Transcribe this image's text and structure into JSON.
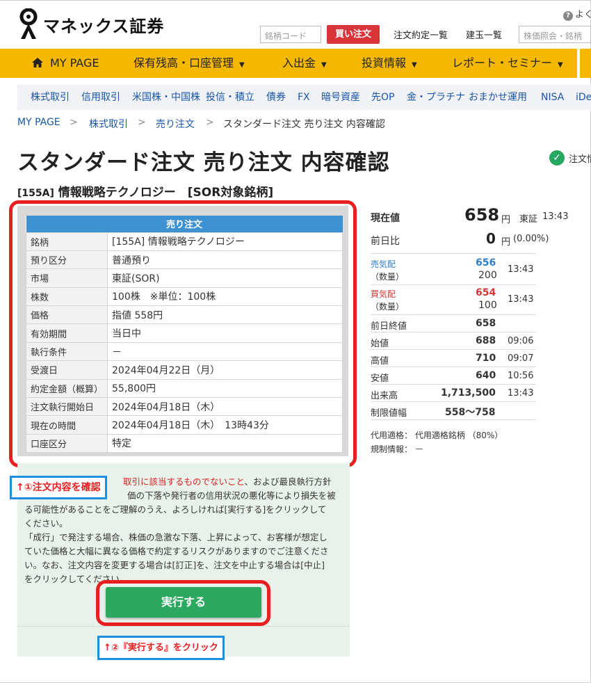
{
  "header": {
    "brand": "マネックス証券",
    "help_text": "よく",
    "code_input_placeholder": "銘柄コード",
    "buy_order_label": "買い注文",
    "links": [
      "注文約定一覧",
      "建玉一覧"
    ],
    "stock_search_placeholder": "株価照会・銘柄"
  },
  "main_nav": {
    "home": "MY PAGE",
    "items": [
      "保有残高・口座管理",
      "入出金",
      "投資情報",
      "レポート・セミナー"
    ]
  },
  "sub_nav": [
    "株式取引",
    "信用取引",
    "米国株・中国株",
    "投信・積立",
    "債券",
    "FX",
    "暗号資産",
    "先OP",
    "金・プラチナ",
    "おまかせ運用",
    "NISA",
    "iDe"
  ],
  "breadcrumb": [
    "MY PAGE",
    "株式取引",
    "売り注文",
    "スタンダード注文 売り注文 内容確認"
  ],
  "page_title": "スタンダード注文 売り注文 内容確認",
  "status_chip": "注文情",
  "stock": {
    "code": "[155A]",
    "name": "情報戦略テクノロジー　[SOR対象銘柄]"
  },
  "order": {
    "caption": "売り注文",
    "rows": [
      {
        "label": "銘柄",
        "value": "[155A] 情報戦略テクノロジー"
      },
      {
        "label": "預り区分",
        "value": "普通預り"
      },
      {
        "label": "市場",
        "value": "東証(SOR)"
      },
      {
        "label": "株数",
        "value": "100株　※単位：100株"
      },
      {
        "label": "価格",
        "value": "指値 558円"
      },
      {
        "label": "有効期間",
        "value": "当日中"
      },
      {
        "label": "執行条件",
        "value": "－"
      },
      {
        "label": "受渡日",
        "value": "2024年04月22日（月）"
      },
      {
        "label": "約定金額（概算）",
        "value": "55,800円"
      },
      {
        "label": "注文執行開始日",
        "value": "2024年04月18日（木）"
      },
      {
        "label": "現在の時間",
        "value": "2024年04月18日（木）　13時43分"
      },
      {
        "label": "口座区分",
        "value": "特定"
      }
    ]
  },
  "notice": {
    "line1_red": "取引に該当するものでないこと",
    "line1_rest": "、および最良執行方針",
    "line2": "価の下落や発行者の信用状況の悪化等により損失を被",
    "line3": "る可能性があることをご理解のうえ、よろしければ[実行する]をクリックして",
    "line4": "ください。",
    "line5": "「成行」で発注する場合、株価の急激な下落、上昇によって、お客様が想定し",
    "line6": "ていた価格と大幅に異なる価格で約定するリスクがありますのでご注意くださ",
    "line7": "い。なお、注文内容を変更する場合は[訂正]を、注文を中止する場合は[中止]",
    "line8": "をクリックしてください。"
  },
  "execute_label": "実行する",
  "callouts": {
    "one": "↑①注文内容を確認",
    "two": "↑②『実行する』をクリック"
  },
  "quote": {
    "current_label": "現在値",
    "current_value": "658",
    "current_unit": "円",
    "market": "東証",
    "current_time": "13:43",
    "change_label": "前日比",
    "change_value": "0",
    "change_unit": "円",
    "change_pct": "(0.00%)",
    "ask_label": "売気配",
    "ask_value": "656",
    "ask_qty_label": "（数量）",
    "ask_qty": "200",
    "ask_time": "13:43",
    "bid_label": "買気配",
    "bid_value": "654",
    "bid_qty_label": "（数量）",
    "bid_qty": "100",
    "bid_time": "13:43",
    "stats": [
      {
        "label": "前日終値",
        "value": "658",
        "time": ""
      },
      {
        "label": "始値",
        "value": "688",
        "time": "09:06"
      },
      {
        "label": "高値",
        "value": "710",
        "time": "09:07"
      },
      {
        "label": "安値",
        "value": "640",
        "time": "10:56"
      },
      {
        "label": "出来高",
        "value": "1,713,500",
        "time": "13:43"
      },
      {
        "label": "制限値幅",
        "value": "558〜758",
        "time": ""
      }
    ],
    "collateral": "代用適格：  代用適格銘柄 （80%）",
    "regulation": "規制情報：  －"
  },
  "colors": {
    "nav_yellow": "#f5b800",
    "link_blue": "#1a56a8",
    "buy_red": "#d8343a",
    "execute_green": "#2ca860",
    "highlight_red": "#e81f1f",
    "callout_blue": "#1e8fe0",
    "table_header_blue": "#3f92d2"
  }
}
